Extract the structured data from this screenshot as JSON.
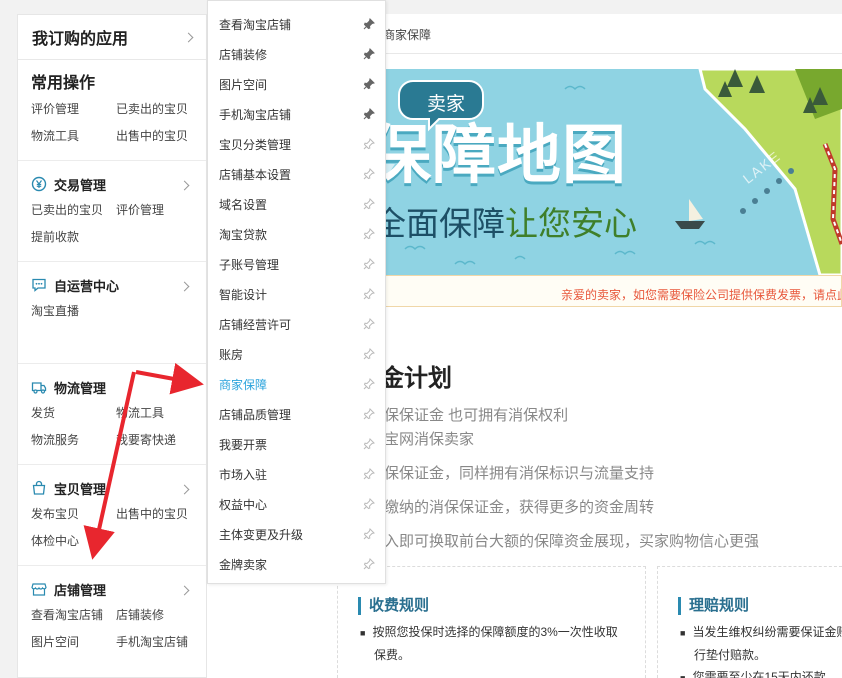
{
  "sidebar": {
    "header": "我订购的应用",
    "common": {
      "title": "常用操作",
      "items": [
        "评价管理",
        "已卖出的宝贝",
        "物流工具",
        "出售中的宝贝"
      ]
    },
    "sections": [
      {
        "title": "交易管理",
        "icon": "yen-icon",
        "items": [
          "已卖出的宝贝",
          "评价管理",
          "提前收款"
        ]
      },
      {
        "title": "自运营中心",
        "icon": "chat-icon",
        "items": [
          "淘宝直播"
        ]
      },
      {
        "title": "物流管理",
        "icon": "truck-icon",
        "items": [
          "发货",
          "物流工具",
          "物流服务",
          "我要寄快递"
        ]
      },
      {
        "title": "宝贝管理",
        "icon": "bag-icon",
        "items": [
          "发布宝贝",
          "出售中的宝贝",
          "体检中心"
        ]
      },
      {
        "title": "店铺管理",
        "icon": "store-icon",
        "items": [
          "查看淘宝店铺",
          "店铺装修",
          "图片空间",
          "手机淘宝店铺"
        ]
      }
    ]
  },
  "breadcrumb": "商家保障",
  "menu": {
    "active_index": 12,
    "items": [
      "查看淘宝店铺",
      "店铺装修",
      "图片空间",
      "手机淘宝店铺",
      "宝贝分类管理",
      "店铺基本设置",
      "域名设置",
      "淘宝贷款",
      "子账号管理",
      "智能设计",
      "店铺经营许可",
      "账房",
      "商家保障",
      "店铺品质管理",
      "我要开票",
      "市场入驻",
      "权益中心",
      "主体变更及升级",
      "金牌卖家"
    ],
    "pinned_count": 4
  },
  "banner": {
    "badge": "卖家",
    "title": "保障地图",
    "subtitle_a": "全面保障",
    "subtitle_b": "让您安心",
    "lake_label": "LAKE",
    "colors": {
      "sky": "#8fd3e3",
      "title": "#ffffff",
      "subtitle": "#1d4f66",
      "accent": "#3f7f2a",
      "badge": "#2a7a93"
    }
  },
  "notice": "亲爱的卖家，如您需要保险公司提供保费发票，请点此",
  "plan": {
    "title": "金计划",
    "lines": [
      "保保证金 也可拥有消保权利",
      "宝网消保卖家",
      "保保证金，同样拥有消保标识与流量支持",
      "缴纳的消保保证金，获得更多的资金周转",
      "入即可换取前台大额的保障资金展现，买家购物信心更强"
    ]
  },
  "rules": {
    "fee": {
      "title": "收费规则",
      "text_1": "按照您投保时选择的保障额度的3%一次性收取",
      "text_2": "保费。"
    },
    "claim": {
      "title": "理赔规则",
      "text_1": "当发生维权纠纷需要保证金赔",
      "text_2": "行垫付赔款。",
      "text_3": "您需要至少在15天内还款"
    }
  },
  "colors": {
    "accent": "#2aa3dc",
    "arrow": "#e8262e",
    "notice": "#e8583c"
  }
}
